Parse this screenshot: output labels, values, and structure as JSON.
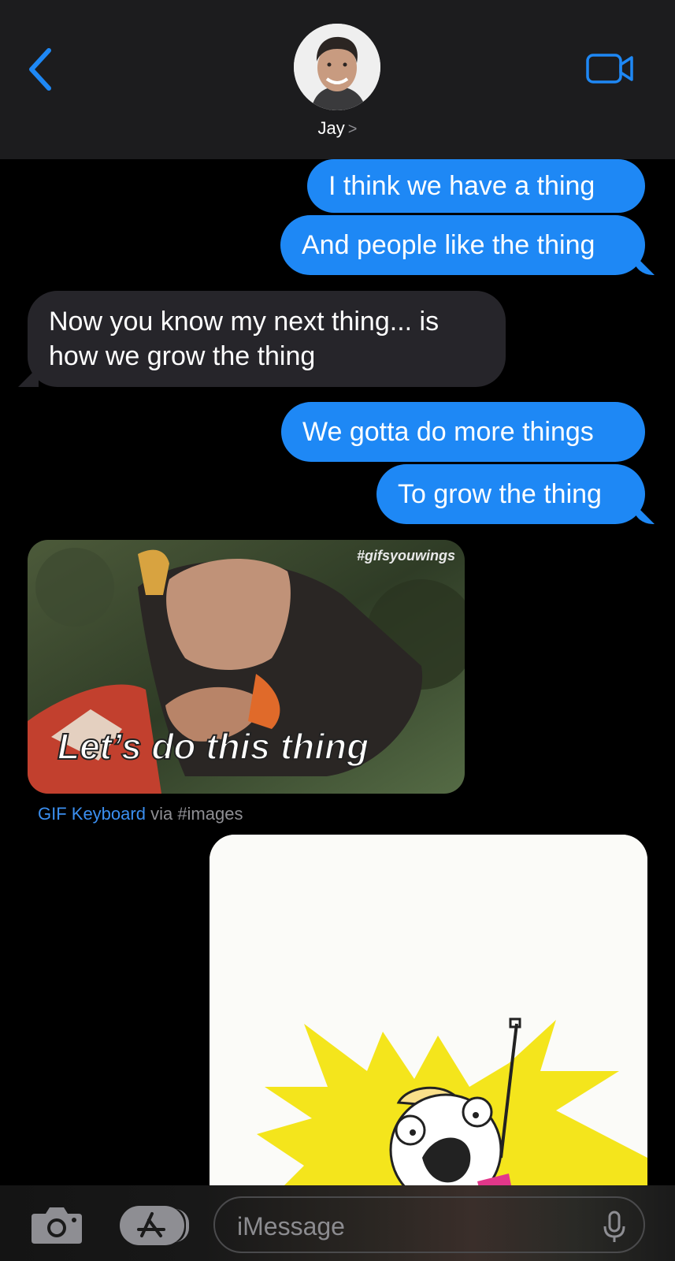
{
  "header": {
    "contact_name": "Jay",
    "chevron": ">",
    "icons": {
      "back": "chevron-left-icon",
      "video": "video-camera-icon"
    },
    "accent_color": "#1e88f5"
  },
  "messages": [
    {
      "direction": "outgoing",
      "text": "I think we have a thing"
    },
    {
      "direction": "outgoing",
      "text": "And people like the thing"
    },
    {
      "direction": "incoming",
      "text": "Now you know my next thing... is how we grow the thing"
    },
    {
      "direction": "outgoing",
      "text": "We gotta do more things"
    },
    {
      "direction": "outgoing",
      "text": "To grow the thing"
    }
  ],
  "gif": {
    "tag": "#gifsyouwings",
    "caption": "Let’s do this thing",
    "attribution_app": "GIF Keyboard",
    "attribution_suffix": "via #images"
  },
  "composer": {
    "placeholder": "iMessage",
    "icons": {
      "camera": "camera-icon",
      "app_store": "app-store-icon",
      "mic": "microphone-icon"
    }
  },
  "colors": {
    "outgoing_bubble": "#1e88f5",
    "incoming_bubble": "#26252a",
    "background": "#000000"
  }
}
